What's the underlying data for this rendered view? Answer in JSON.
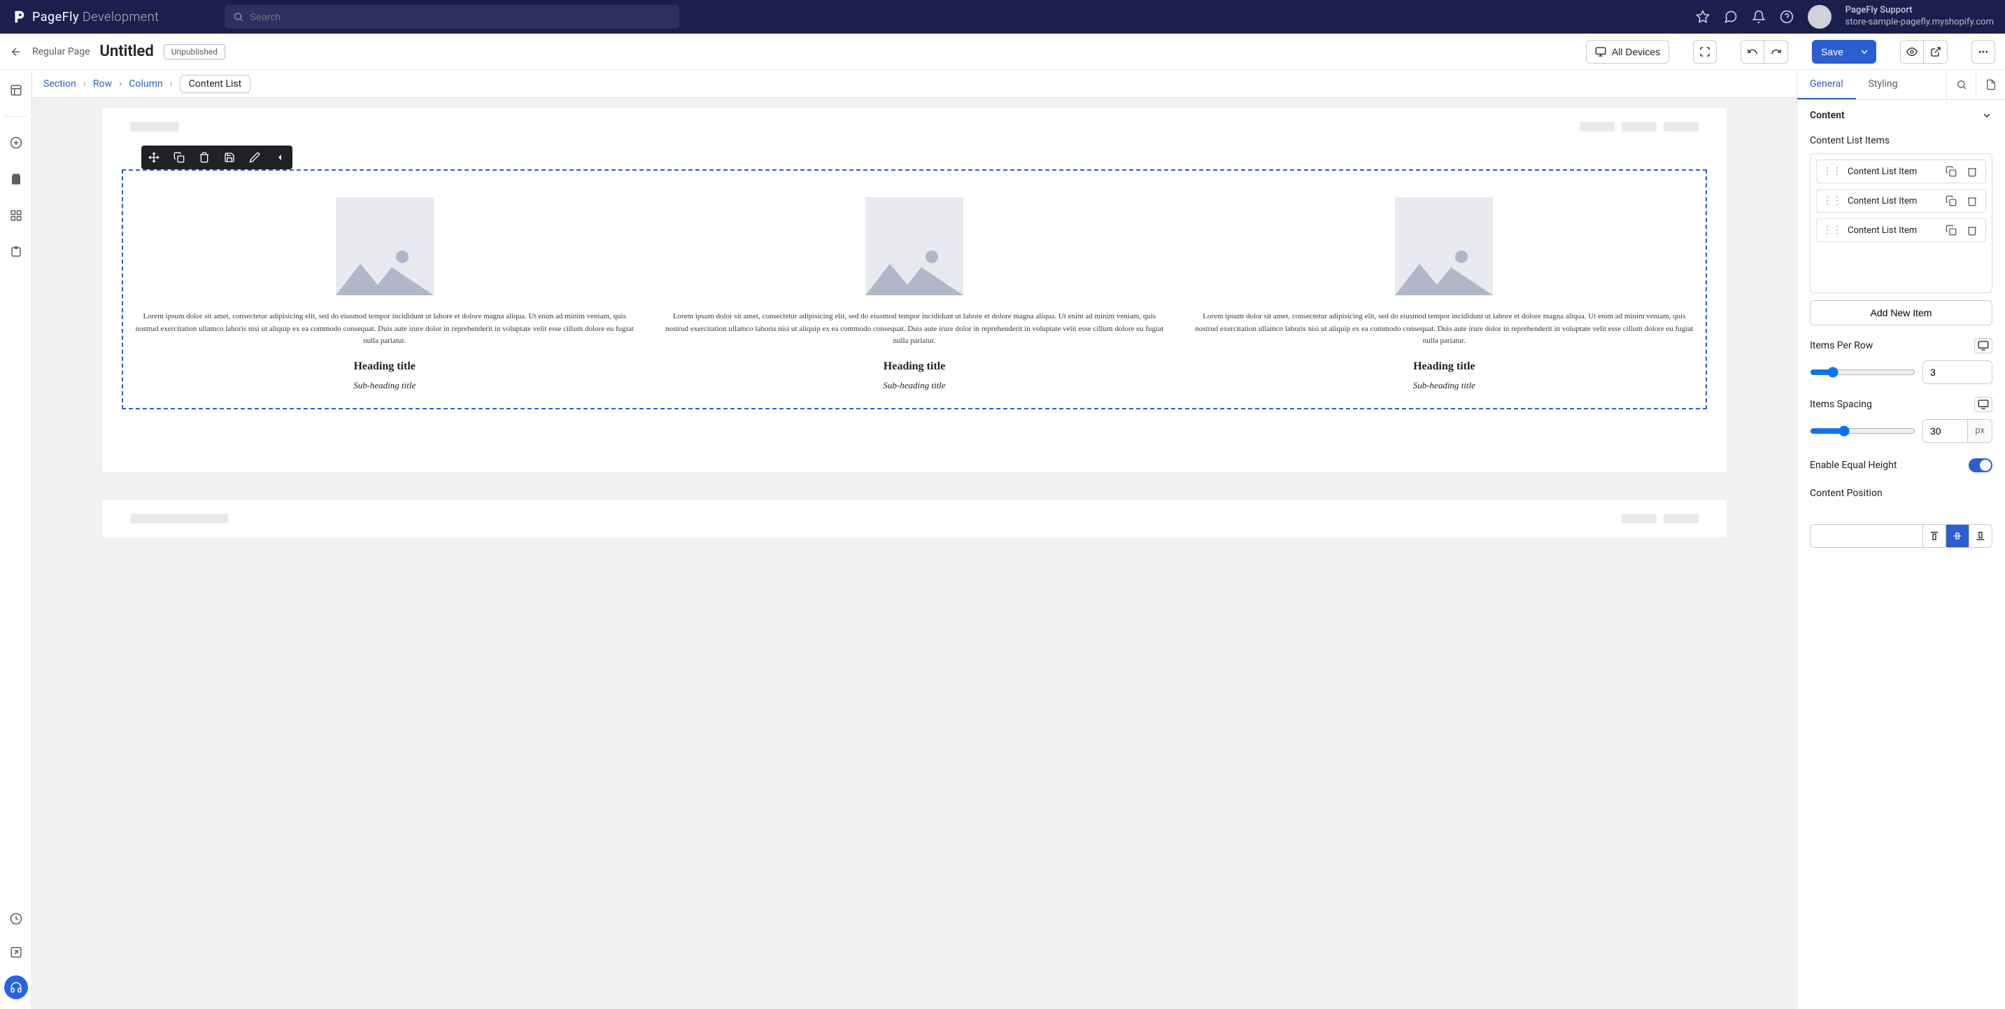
{
  "topnav": {
    "brand_main": "PageFly",
    "brand_sub": "Development",
    "search_placeholder": "Search",
    "user_name": "PageFly Support",
    "user_shop": "store-sample-pagefly.myshopify.com"
  },
  "secondbar": {
    "page_type": "Regular Page",
    "page_title": "Untitled",
    "status_badge": "Unpublished",
    "devices_label": "All Devices",
    "save_label": "Save"
  },
  "breadcrumb": {
    "items": [
      "Section",
      "Row",
      "Column"
    ],
    "current": "Content List"
  },
  "content_list": {
    "lorem": "Lorem ipsum dolor sit amet, consectetur adipisicing elit, sed do eiusmod tempor incididunt ut labore et dolore magna aliqua. Ut enim ad minim veniam, quis nostrud exercitation ullamco laboris nisi ut aliquip ex ea commodo consequat. Duis aute irure dolor in reprehenderit in voluptate velit esse cillum dolore eu fugiat nulla pariatur.",
    "heading": "Heading title",
    "subheading": "Sub-heading title"
  },
  "panel": {
    "tab_general": "General",
    "tab_styling": "Styling",
    "section_content": "Content",
    "content_list_items_label": "Content List Items",
    "item_label": "Content List Item",
    "add_new_item": "Add New Item",
    "items_per_row_label": "Items Per Row",
    "items_per_row_value": "3",
    "items_spacing_label": "Items Spacing",
    "items_spacing_value": "30",
    "spacing_unit": "px",
    "enable_equal_height": "Enable Equal Height",
    "content_position": "Content Position"
  }
}
